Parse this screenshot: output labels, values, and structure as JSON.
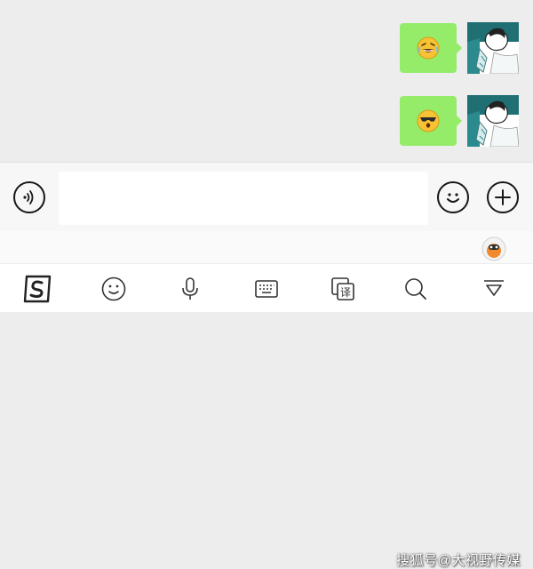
{
  "chat": {
    "messages": [
      {
        "sender": "me",
        "type": "emoji-sticker",
        "icon": "laughing-crying-emoji"
      },
      {
        "sender": "me",
        "type": "emoji-sticker",
        "icon": "sunglasses-emoji"
      }
    ]
  },
  "input_bar": {
    "voice_icon": "voice-icon",
    "text_value": "",
    "emoji_icon": "smiley-icon",
    "more_icon": "plus-icon"
  },
  "keyboard_toolbar": {
    "items": [
      "sogou-logo",
      "emoji-icon",
      "microphone-icon",
      "keyboard-icon",
      "translate-icon",
      "search-icon",
      "collapse-icon"
    ],
    "translate_glyph": "译"
  },
  "watermark": "搜狐号@大视野传媒",
  "colors": {
    "bubble": "#95ec69",
    "chat_bg": "#ededed",
    "input_bg": "#f7f7f7"
  }
}
